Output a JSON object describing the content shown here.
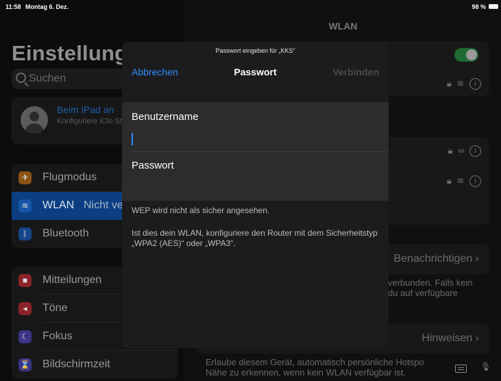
{
  "status_bar": {
    "time": "11:58",
    "date": "Montag 6. Dez.",
    "battery": "98 %"
  },
  "sidebar": {
    "title": "Einstellung",
    "search_placeholder": "Suchen",
    "profile": {
      "name": "Beim iPad an",
      "subtitle": "Konfiguriere iClo Store etc."
    },
    "items": [
      {
        "label": "Flugmodus",
        "icon": "airplane-icon",
        "color": "#e8861f"
      },
      {
        "label": "WLAN",
        "value": "Nicht ve",
        "icon": "wifi-icon",
        "color": "#1c6fd8",
        "selected": true
      },
      {
        "label": "Bluetooth",
        "icon": "bluetooth-icon",
        "color": "#1c6fd8"
      },
      {
        "label": "Mitteilungen",
        "icon": "notifications-icon",
        "color": "#d9363e"
      },
      {
        "label": "Töne",
        "icon": "sound-icon",
        "color": "#d9363e"
      },
      {
        "label": "Fokus",
        "icon": "moon-icon",
        "color": "#5a4fcf"
      },
      {
        "label": "Bildschirmzeit",
        "icon": "hourglass-icon",
        "color": "#5a4fcf"
      }
    ]
  },
  "detail": {
    "title": "WLAN",
    "ask_join_label": "Benachrichtigen",
    "ask_join_text": "verbunden. Falls kein du auf verfügbare",
    "hotspot_label": "Hinweisen",
    "hotspot_text": "Erlaube diesem Gerät, automatisch persönliche Hotspo Nähe zu erkennen, wenn kein WLAN verfügbar ist."
  },
  "modal": {
    "subtitle": "Passwort eingeben für „KKS“",
    "cancel": "Abbrechen",
    "title": "Passwort",
    "connect": "Verbinden",
    "username_label": "Benutzername",
    "username_value": "",
    "password_label": "Passwort",
    "password_value": "",
    "warning": "WEP wird nicht als sicher angesehen.",
    "advice": "Ist dies dein WLAN, konfiguriere den Router mit dem Sicherheitstyp „WPA2 (AES)“ oder „WPA3“."
  }
}
